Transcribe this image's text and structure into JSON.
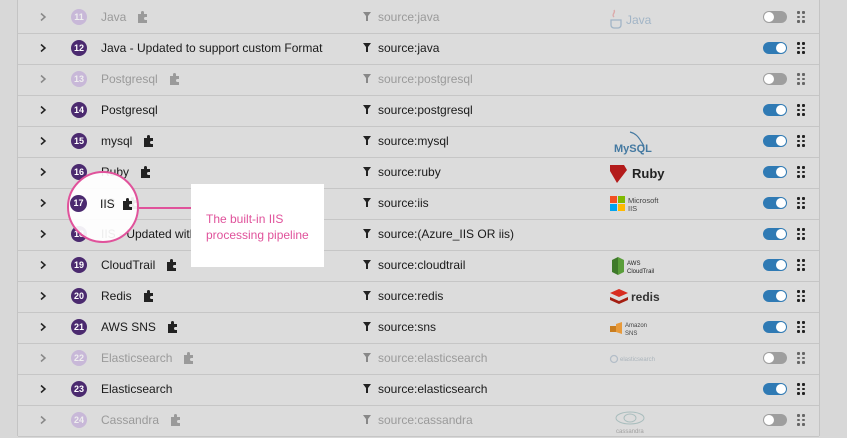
{
  "rows": [
    {
      "num": "11",
      "name": "Java",
      "query": "source:java",
      "enabled": false,
      "logo": "java-logo",
      "logo_text": "Java"
    },
    {
      "num": "12",
      "name": "Java - Updated to support custom Format",
      "query": "source:java",
      "enabled": true,
      "logo": "",
      "logo_text": ""
    },
    {
      "num": "13",
      "name": "Postgresql",
      "query": "source:postgresql",
      "enabled": false,
      "logo": "",
      "logo_text": ""
    },
    {
      "num": "14",
      "name": "Postgresql",
      "query": "source:postgresql",
      "enabled": true,
      "logo": "",
      "logo_text": ""
    },
    {
      "num": "15",
      "name": "mysql",
      "query": "source:mysql",
      "enabled": true,
      "logo": "mysql-logo",
      "logo_text": "MySQL"
    },
    {
      "num": "16",
      "name": "Ruby",
      "query": "source:ruby",
      "enabled": true,
      "logo": "ruby-logo",
      "logo_text": "Ruby"
    },
    {
      "num": "17",
      "name": "IIS",
      "query": "source:iis",
      "enabled": true,
      "logo": "microsoft-iis-logo",
      "logo_text": "Microsoft IIS"
    },
    {
      "num": "18",
      "name": "IIS - Updated with",
      "query": "source:(Azure_IIS OR iis)",
      "enabled": true,
      "logo": "",
      "logo_text": ""
    },
    {
      "num": "19",
      "name": "CloudTrail",
      "query": "source:cloudtrail",
      "enabled": true,
      "logo": "aws-cloudtrail-logo",
      "logo_text": "AWS CloudTrail"
    },
    {
      "num": "20",
      "name": "Redis",
      "query": "source:redis",
      "enabled": true,
      "logo": "redis-logo",
      "logo_text": "redis"
    },
    {
      "num": "21",
      "name": "AWS SNS",
      "query": "source:sns",
      "enabled": true,
      "logo": "amazon-sns-logo",
      "logo_text": "Amazon SNS"
    },
    {
      "num": "22",
      "name": "Elasticsearch",
      "query": "source:elasticsearch",
      "enabled": false,
      "logo": "elasticsearch-logo",
      "logo_text": "elasticsearch"
    },
    {
      "num": "23",
      "name": "Elasticsearch",
      "query": "source:elasticsearch",
      "enabled": true,
      "logo": "",
      "logo_text": ""
    },
    {
      "num": "24",
      "name": "Cassandra",
      "query": "source:cassandra",
      "enabled": false,
      "logo": "cassandra-logo",
      "logo_text": "cassandra"
    }
  ],
  "callout": {
    "row_num": "17",
    "row_name": "IIS",
    "text": "The built-in IIS processing pipeline"
  },
  "colors": {
    "badge": "#4b2a6f",
    "toggle_on": "#2f7ab4",
    "toggle_off": "#9e9e9e",
    "callout": "#e0529b"
  }
}
